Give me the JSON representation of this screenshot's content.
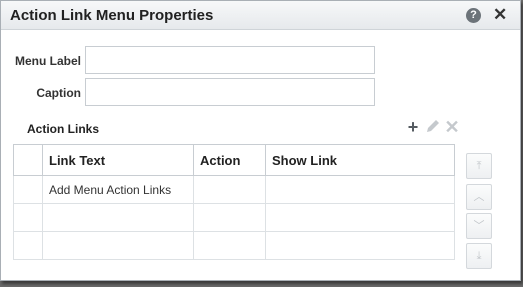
{
  "dialog": {
    "title": "Action Link Menu Properties",
    "help_icon": "help-icon",
    "close_icon": "close-icon"
  },
  "form": {
    "menu_label": {
      "label": "Menu Label",
      "value": ""
    },
    "caption": {
      "label": "Caption",
      "value": ""
    }
  },
  "action_links": {
    "section_label": "Action Links",
    "toolbar_icons": [
      "plus-icon",
      "pencil-icon",
      "delete-icon"
    ],
    "columns": [
      "Link Text",
      "Action",
      "Show Link"
    ],
    "rows": [
      [
        "Add Menu Action Links",
        "",
        ""
      ],
      [
        "",
        "",
        ""
      ],
      [
        "",
        "",
        ""
      ]
    ]
  },
  "reorder_icons": [
    "move-top-icon",
    "move-up-icon",
    "move-down-icon",
    "move-bottom-icon"
  ],
  "colors": {
    "border": "#c8cdd2",
    "titlebar": "#eceff1",
    "disabled_icon": "#c5c9cd"
  }
}
